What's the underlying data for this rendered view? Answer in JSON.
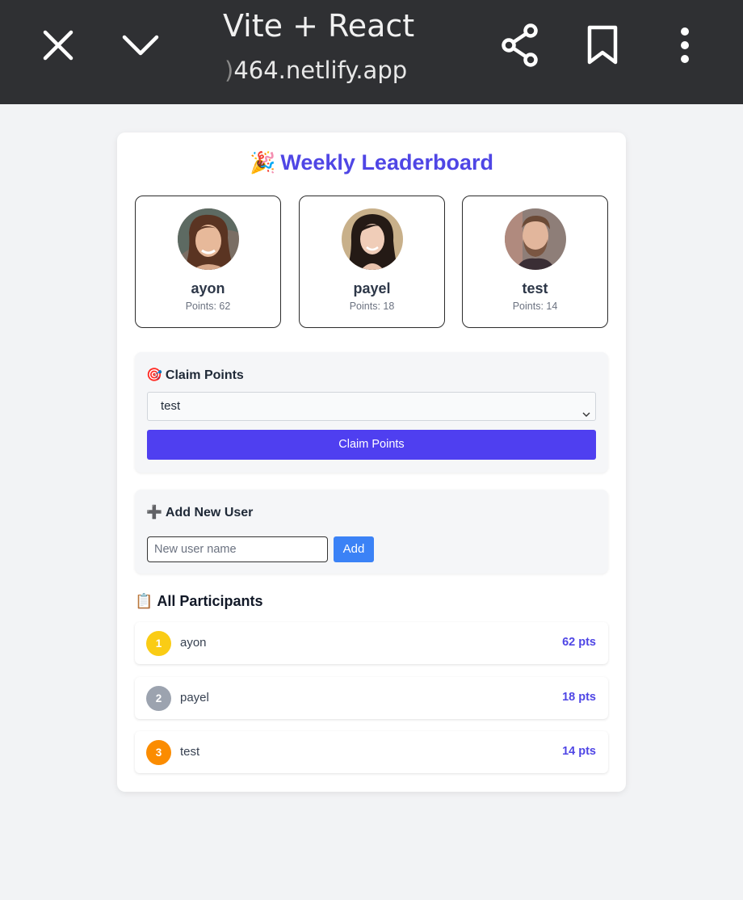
{
  "browser": {
    "title": "Vite + React",
    "url": "464.netlify.app"
  },
  "app": {
    "heading": "Weekly Leaderboard",
    "heading_emoji": "🎉"
  },
  "top3": [
    {
      "name": "ayon",
      "points_label": "Points: 62"
    },
    {
      "name": "payel",
      "points_label": "Points: 18"
    },
    {
      "name": "test",
      "points_label": "Points: 14"
    }
  ],
  "claim": {
    "emoji": "🎯",
    "title": "Claim Points",
    "selected": "test",
    "button": "Claim Points"
  },
  "add_user": {
    "emoji": "➕",
    "title": "Add New User",
    "placeholder": "New user name",
    "button": "Add"
  },
  "participants": {
    "emoji": "📋",
    "title": "All Participants",
    "rows": [
      {
        "rank": "1",
        "name": "ayon",
        "points": "62 pts",
        "color": "#facc15"
      },
      {
        "rank": "2",
        "name": "payel",
        "points": "18 pts",
        "color": "#9ca3af"
      },
      {
        "rank": "3",
        "name": "test",
        "points": "14 pts",
        "color": "#fb8c00"
      }
    ]
  },
  "colors": {
    "accent": "#4f46e5",
    "claim_button": "#4f3ff0",
    "add_button": "#3b82f6",
    "topbar": "#2f3033"
  }
}
